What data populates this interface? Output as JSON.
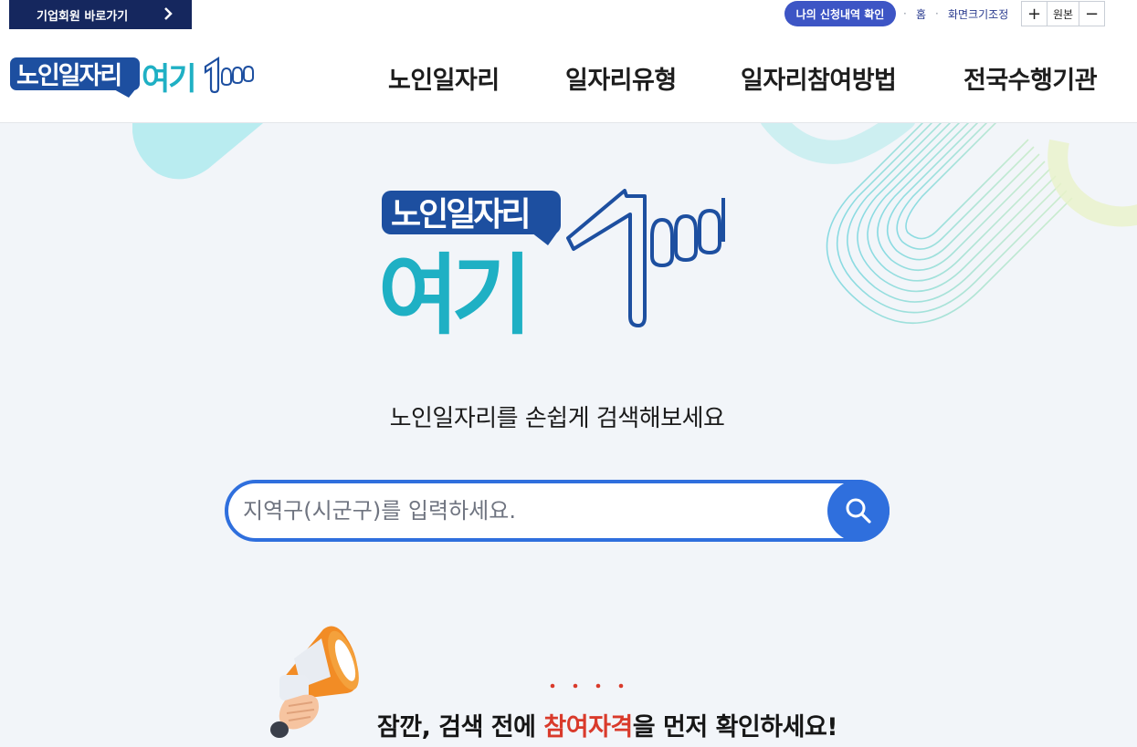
{
  "utility": {
    "corp_label": "기업회원 바로가기",
    "apply_label": "나의 신청내역 확인",
    "home_label": "홈",
    "resize_label": "화면크기조정",
    "zoom_in": "+",
    "zoom_reset": "원본",
    "zoom_out": "−"
  },
  "header": {
    "logo": {
      "top_text": "노인일자리",
      "bottom_text": "여기",
      "suffix": "100"
    },
    "nav": [
      "노인일자리",
      "일자리유형",
      "일자리참여방법",
      "전국수행기관"
    ]
  },
  "hero": {
    "logo": {
      "top_text": "노인일자리",
      "bottom_text": "여기"
    },
    "tagline": "노인일자리를 손쉽게 검색해보세요",
    "search": {
      "placeholder": "지역구(시군구)를 입력하세요.",
      "value": ""
    },
    "notice": {
      "prefix": "잠깐, 검색 전에 ",
      "emphasis": "참여자격",
      "suffix": "을 먼저 확인하세요!"
    }
  },
  "colors": {
    "navy": "#15275e",
    "brand_blue": "#1d4fa0",
    "brand_teal": "#1fb0c4",
    "search_blue": "#2f6fdd",
    "accent_red": "#d93a2b",
    "hero_bg": "#f2f5f9"
  },
  "icons": [
    "chevron-right-icon",
    "search-icon",
    "megaphone-icon",
    "pointing-finger-icon"
  ]
}
